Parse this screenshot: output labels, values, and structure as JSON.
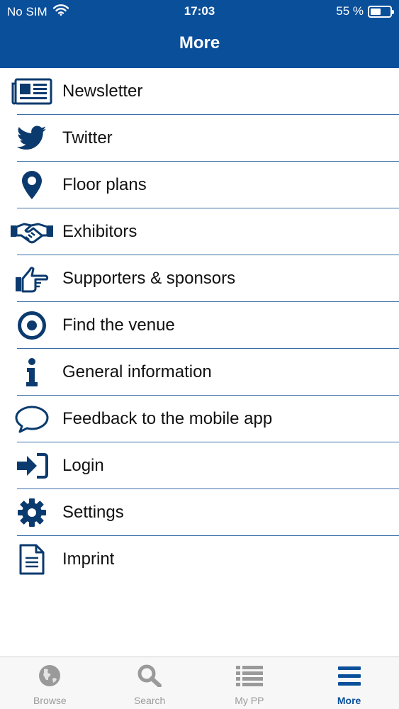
{
  "status_bar": {
    "carrier": "No SIM",
    "time": "17:03",
    "battery_text": "55 %",
    "battery_level": 0.55
  },
  "header": {
    "title": "More"
  },
  "menu": {
    "items": [
      {
        "label": "Newsletter",
        "icon": "newspaper-icon"
      },
      {
        "label": "Twitter",
        "icon": "twitter-bird-icon"
      },
      {
        "label": "Floor plans",
        "icon": "map-pin-icon"
      },
      {
        "label": "Exhibitors",
        "icon": "handshake-icon"
      },
      {
        "label": "Supporters & sponsors",
        "icon": "pointing-hand-icon"
      },
      {
        "label": "Find the venue",
        "icon": "target-icon"
      },
      {
        "label": "General information",
        "icon": "info-icon"
      },
      {
        "label": "Feedback to the mobile app",
        "icon": "speech-bubble-icon"
      },
      {
        "label": "Login",
        "icon": "login-arrow-icon"
      },
      {
        "label": "Settings",
        "icon": "gear-icon"
      },
      {
        "label": "Imprint",
        "icon": "document-icon"
      }
    ]
  },
  "tab_bar": {
    "tabs": [
      {
        "label": "Browse",
        "icon": "globe-icon",
        "active": false
      },
      {
        "label": "Search",
        "icon": "search-icon",
        "active": false
      },
      {
        "label": "My PP",
        "icon": "list-icon",
        "active": false
      },
      {
        "label": "More",
        "icon": "hamburger-icon",
        "active": true
      }
    ]
  },
  "colors": {
    "brand": "#0a4f9a",
    "icon": "#0b3a6e",
    "tab_inactive": "#9a9a9a",
    "divider": "#3a6fa8"
  }
}
